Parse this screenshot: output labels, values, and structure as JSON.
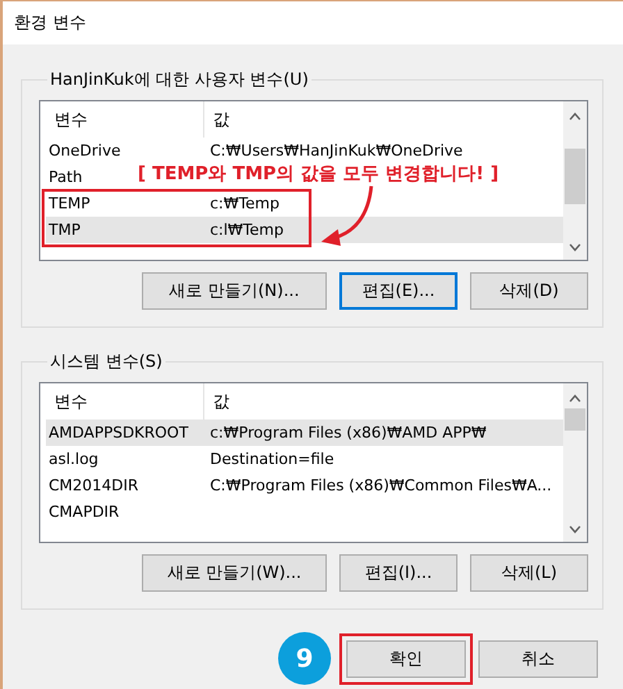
{
  "window": {
    "title": "환경 변수"
  },
  "user_variables": {
    "legend": "HanJinKuk에 대한 사용자 변수(U)",
    "columns": [
      "변수",
      "값"
    ],
    "rows": [
      {
        "name": "OneDrive",
        "value": "C:₩Users₩HanJinKuk₩OneDrive",
        "selected": false,
        "highlighted": false
      },
      {
        "name": "Path",
        "selected": false,
        "highlighted": false
      },
      {
        "name": "TEMP",
        "value": "c:₩Temp",
        "selected": false,
        "highlighted": true
      },
      {
        "name": "TMP",
        "value": "c:l₩Temp",
        "selected": true,
        "highlighted": true
      }
    ],
    "buttons": [
      {
        "label": "새로 만들기(N)...",
        "focused": false
      },
      {
        "label": "편집(E)...",
        "focused": true
      },
      {
        "label": "삭제(D)",
        "focused": false
      }
    ]
  },
  "callout": {
    "text": "[ TEMP와 TMP의 값을 모두 변경합니다! ]"
  },
  "system_variables": {
    "legend": "시스템 변수(S)",
    "columns": [
      "변수",
      "값"
    ],
    "rows": [
      {
        "name": "AMDAPPSDKROOT",
        "value": "c:₩Program Files (x86)₩AMD APP₩",
        "selected": true,
        "highlighted": false
      },
      {
        "name": "asl.log",
        "value": "Destination=file",
        "selected": false,
        "highlighted": false
      },
      {
        "name": "CM2014DIR",
        "value": "C:₩Program Files (x86)₩Common Files₩A...",
        "selected": false,
        "highlighted": false
      },
      {
        "name": "CMAPDIR",
        "selected": false,
        "highlighted": false
      }
    ],
    "buttons": [
      {
        "label": "새로 만들기(W)...",
        "focused": false
      },
      {
        "label": "편집(I)...",
        "focused": false
      },
      {
        "label": "삭제(L)",
        "focused": false
      }
    ]
  },
  "step_badge": "9",
  "footer_buttons": [
    {
      "label": "확인",
      "highlighted": true
    },
    {
      "label": "취소",
      "highlighted": false
    }
  ]
}
